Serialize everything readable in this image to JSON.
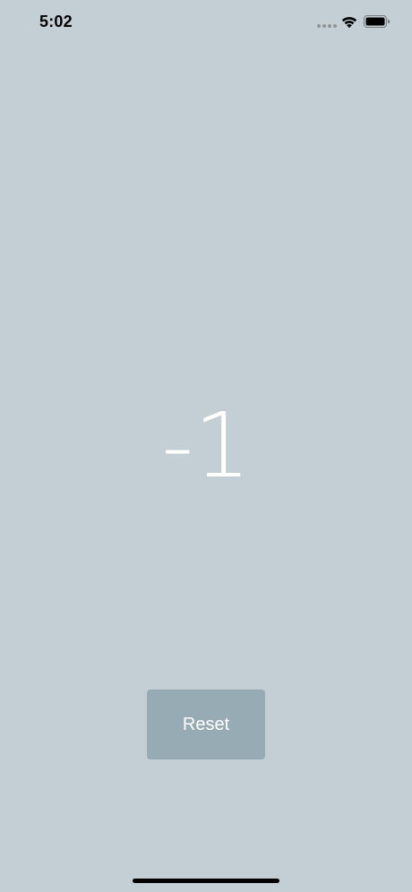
{
  "status_bar": {
    "time": "5:02",
    "icons": [
      "signal-dots-icon",
      "wifi-icon",
      "battery-icon"
    ]
  },
  "counter": {
    "value": "-1"
  },
  "reset_button": {
    "label": "Reset"
  },
  "colors": {
    "background": "#c3cfd5",
    "button": "#97abb4",
    "text": "#ffffff"
  }
}
